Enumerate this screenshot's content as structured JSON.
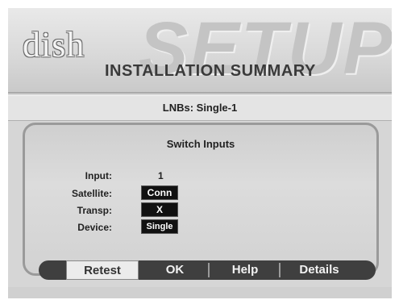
{
  "header": {
    "logo_text": "dish",
    "watermark": "SETUP",
    "title": "INSTALLATION SUMMARY"
  },
  "lnb_bar": {
    "text": "LNBs: Single-1"
  },
  "panel": {
    "title": "Switch Inputs",
    "rows": [
      {
        "label": "Input:",
        "value": "1"
      },
      {
        "label": "Satellite:",
        "value": "Conn"
      },
      {
        "label": "Transp:",
        "value": "X"
      },
      {
        "label": "Device:",
        "value": "Single"
      }
    ]
  },
  "buttons": {
    "retest": "Retest",
    "ok": "OK",
    "help": "Help",
    "details": "Details"
  },
  "colors": {
    "background": "#d6d6d6",
    "button_bar": "#3f3f3f",
    "value_box": "#111111"
  }
}
